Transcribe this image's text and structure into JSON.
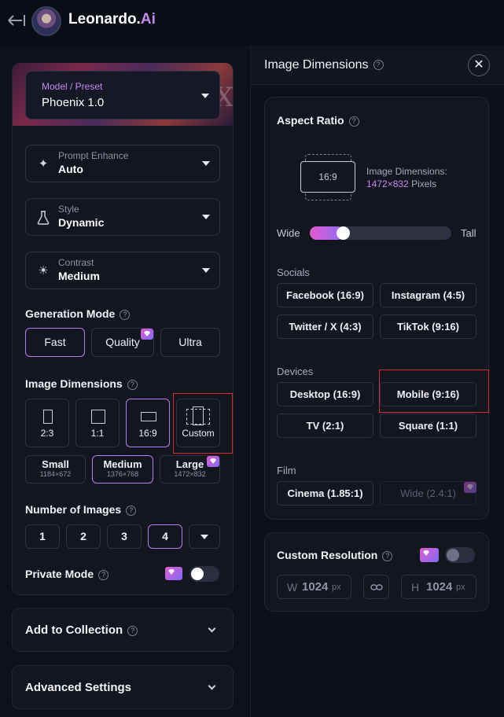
{
  "app": {
    "name_main": "Leonardo.",
    "name_accent": "Ai"
  },
  "preset": {
    "label": "Model / Preset",
    "value": "Phoenix 1.0",
    "banner_text": "ENIX"
  },
  "prompt_enhance": {
    "label": "Prompt Enhance",
    "value": "Auto",
    "icon": "sparkle-icon"
  },
  "style": {
    "label": "Style",
    "value": "Dynamic",
    "icon": "flask-icon"
  },
  "contrast": {
    "label": "Contrast",
    "value": "Medium",
    "icon": "sun-icon"
  },
  "generation_mode": {
    "title": "Generation Mode",
    "options": [
      "Fast",
      "Quality",
      "Ultra"
    ],
    "selected": "Fast"
  },
  "image_dimensions": {
    "title": "Image Dimensions",
    "ratios": [
      "2:3",
      "1:1",
      "16:9",
      "Custom"
    ],
    "selected_ratio": "16:9",
    "sizes": [
      {
        "name": "Small",
        "res": "1184×672"
      },
      {
        "name": "Medium",
        "res": "1376×768"
      },
      {
        "name": "Large",
        "res": "1472×832"
      }
    ],
    "selected_size": "Medium"
  },
  "number_of_images": {
    "title": "Number of Images",
    "options": [
      "1",
      "2",
      "3",
      "4"
    ],
    "selected": "4"
  },
  "private_mode": {
    "title": "Private Mode",
    "enabled": false
  },
  "accordions": {
    "collection": "Add to Collection",
    "advanced": "Advanced Settings"
  },
  "panel": {
    "title": "Image Dimensions",
    "close_glyph": "✕",
    "aspect_ratio": {
      "title": "Aspect Ratio",
      "preview_label": "16:9",
      "dims_label": "Image Dimensions:",
      "dims_value": "1472×832",
      "dims_unit": "Pixels",
      "wide_label": "Wide",
      "tall_label": "Tall",
      "slider_value": 0.12
    },
    "socials": {
      "title": "Socials",
      "items": [
        "Facebook (16:9)",
        "Instagram (4:5)",
        "Twitter / X (4:3)",
        "TikTok (9:16)"
      ]
    },
    "devices": {
      "title": "Devices",
      "items": [
        "Desktop (16:9)",
        "Mobile (9:16)",
        "TV (2:1)",
        "Square (1:1)"
      ]
    },
    "film": {
      "title": "Film",
      "items": [
        "Cinema (1.85:1)",
        "Wide (2.4:1)"
      ]
    },
    "custom_resolution": {
      "title": "Custom Resolution",
      "enabled": false,
      "width_prefix": "W",
      "width": "1024",
      "width_unit": "px",
      "height_prefix": "H",
      "height": "1024",
      "height_unit": "px"
    }
  },
  "colors": {
    "accent": "#b67ef0",
    "brand_ai": "#c28af0",
    "highlight": "#d03030"
  }
}
